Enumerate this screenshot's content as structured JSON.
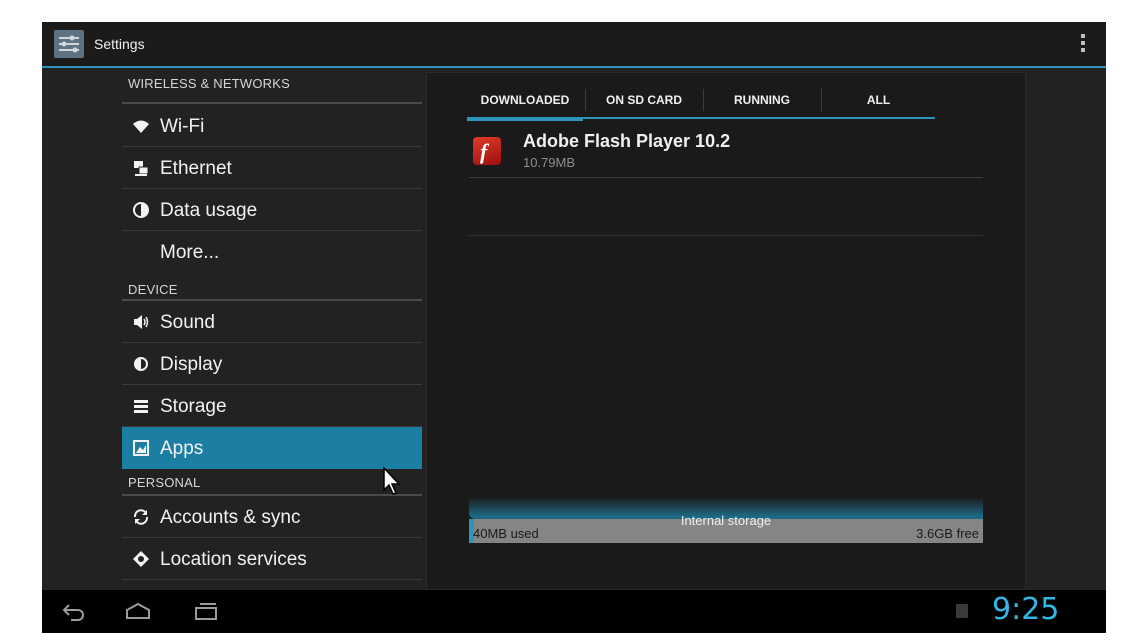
{
  "app": {
    "title": "Settings",
    "accent": "#2e94b9"
  },
  "sidebar": {
    "headers": [
      "WIRELESS & NETWORKS",
      "DEVICE",
      "PERSONAL"
    ],
    "items": [
      {
        "label": "Wi-Fi",
        "icon": "wifi-icon"
      },
      {
        "label": "Ethernet",
        "icon": "ethernet-icon"
      },
      {
        "label": "Data usage",
        "icon": "data-usage-icon"
      },
      {
        "label": "More...",
        "icon": ""
      },
      {
        "label": "Sound",
        "icon": "sound-icon"
      },
      {
        "label": "Display",
        "icon": "display-icon"
      },
      {
        "label": "Storage",
        "icon": "storage-icon"
      },
      {
        "label": "Apps",
        "icon": "apps-icon",
        "selected": true
      },
      {
        "label": "Accounts & sync",
        "icon": "sync-icon"
      },
      {
        "label": "Location services",
        "icon": "location-icon"
      }
    ]
  },
  "tabs": [
    {
      "label": "DOWNLOADED",
      "selected": true
    },
    {
      "label": "ON SD CARD"
    },
    {
      "label": "RUNNING"
    },
    {
      "label": "ALL"
    }
  ],
  "apps": [
    {
      "name": "Adobe Flash Player 10.2",
      "size": "10.79MB",
      "icon": "flash-player-icon"
    }
  ],
  "storage": {
    "label": "Internal storage",
    "used": "40MB used",
    "free": "3.6GB free",
    "used_fraction": 0.01
  },
  "navbar": {
    "time": "9:25"
  }
}
